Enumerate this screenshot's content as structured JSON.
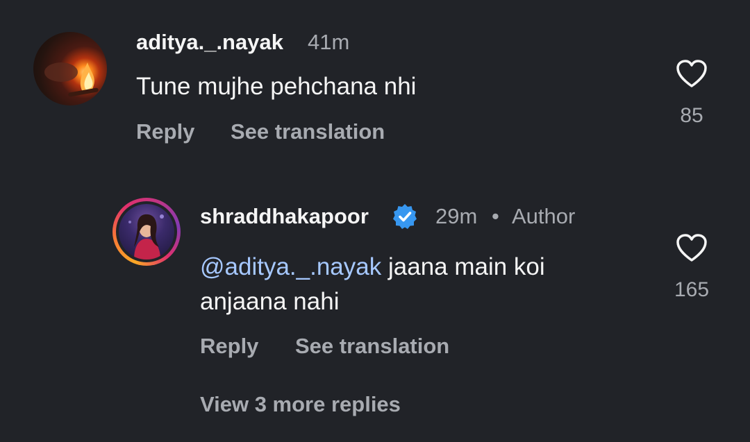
{
  "comments": [
    {
      "username": "aditya._.nayak",
      "time": "41m",
      "text": "Tune mujhe pehchana nhi",
      "reply_label": "Reply",
      "translate_label": "See translation",
      "like_count": "85",
      "like_icon": "heart-outline-icon",
      "avatar_icon": "campfire-avatar"
    }
  ],
  "reply": {
    "username": "shraddhakapoor",
    "verified_icon": "verified-badge-icon",
    "time": "29m",
    "separator": "•",
    "author_label": "Author",
    "mention": "@aditya._.nayak",
    "text_line1": "jaana main koi",
    "text_line2": "anjaana nahi",
    "reply_label": "Reply",
    "translate_label": "See translation",
    "like_count": "165",
    "like_icon": "heart-outline-icon",
    "avatar_icon": "story-ring-avatar"
  },
  "view_more_label": "View 3 more replies",
  "colors": {
    "background": "#212328",
    "primary_text": "#f5f5f5",
    "secondary_text": "#a8abb1",
    "mention": "#a6c8ff",
    "verified": "#3797f0"
  }
}
